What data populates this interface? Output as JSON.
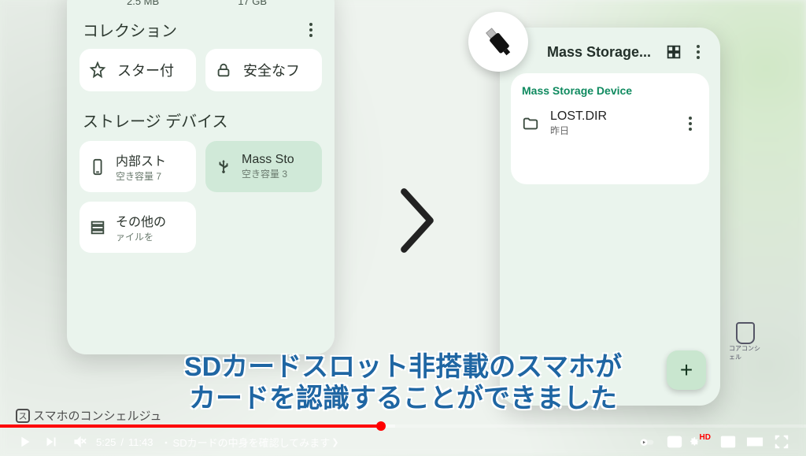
{
  "left_panel": {
    "top_stat": "2.5 MB",
    "top_stat2": "17 GB",
    "collections_title": "コレクション",
    "chips": {
      "starred": "スター付",
      "safe": "安全なフ"
    },
    "storage_title": "ストレージ デバイス",
    "devices": {
      "internal": {
        "title": "内部スト",
        "sub": "空き容量 7"
      },
      "mass": {
        "title": "Mass Sto",
        "sub": "空き容量 3"
      },
      "other": {
        "title": "その他の",
        "sub": "ァイルを"
      }
    }
  },
  "right_panel": {
    "header_title": "Mass Storage...",
    "card_header": "Mass Storage Device",
    "file": {
      "name": "LOST.DIR",
      "date": "昨日"
    },
    "fab": "+"
  },
  "subtitles": {
    "line1": "SDカードスロット非搭載のスマホが",
    "line2": "カードを認識することができました"
  },
  "watermark": "スマホのコンシェルジュ",
  "corner_text": "コアコンシェル",
  "player": {
    "current": "5:25",
    "duration": "11:43",
    "chapter_sep": "・",
    "chapter": "SDカードの中身を確認してみます",
    "hd": "HD"
  }
}
